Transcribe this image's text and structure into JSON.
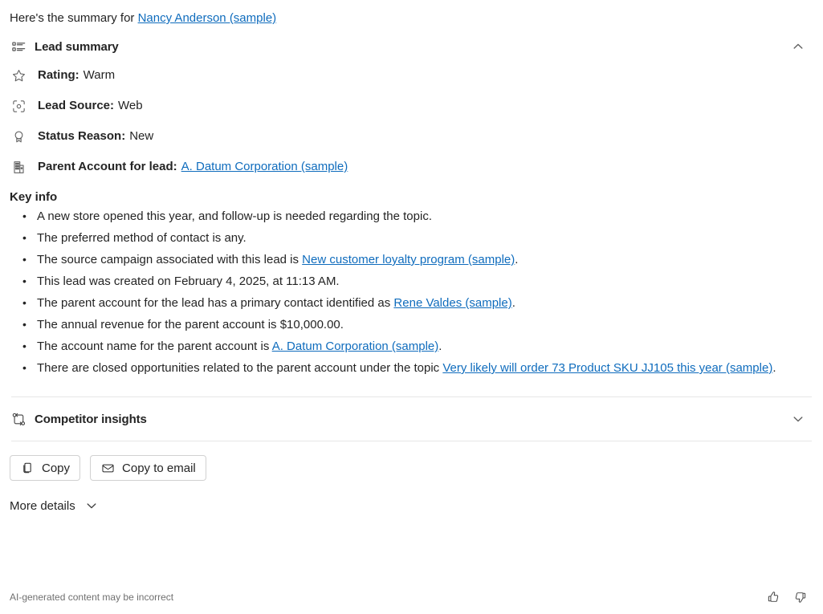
{
  "intro": {
    "prefix": "Here's the summary for ",
    "link": "Nancy Anderson (sample)"
  },
  "lead_summary": {
    "icon": "bulleted-list-icon",
    "title": "Lead summary",
    "collapse_icon": "chevron-up-icon",
    "attributes": [
      {
        "icon": "star-icon",
        "label": "Rating:",
        "value": "Warm"
      },
      {
        "icon": "target-icon",
        "label": "Lead Source:",
        "value": "Web"
      },
      {
        "icon": "ribbon-icon",
        "label": "Status Reason:",
        "value": "New"
      },
      {
        "icon": "building-icon",
        "label": "Parent Account for lead:",
        "value": "A. Datum Corporation (sample)",
        "value_is_link": true
      }
    ],
    "key_info": {
      "title": "Key info",
      "items": [
        {
          "parts": [
            {
              "t": "A new store opened this year, and follow-up is needed regarding the topic."
            }
          ]
        },
        {
          "parts": [
            {
              "t": "The preferred method of contact is any."
            }
          ]
        },
        {
          "parts": [
            {
              "t": "The source campaign associated with this lead is "
            },
            {
              "t": "New customer loyalty program (sample)",
              "link": true
            },
            {
              "t": "."
            }
          ]
        },
        {
          "parts": [
            {
              "t": "This lead was created on February 4, 2025, at 11:13 AM."
            }
          ]
        },
        {
          "parts": [
            {
              "t": "The parent account for the lead has a primary contact identified as "
            },
            {
              "t": "Rene Valdes (sample)",
              "link": true
            },
            {
              "t": "."
            }
          ]
        },
        {
          "parts": [
            {
              "t": "The annual revenue for the parent account is $10,000.00."
            }
          ]
        },
        {
          "parts": [
            {
              "t": "The account name for the parent account is "
            },
            {
              "t": "A. Datum Corporation (sample)",
              "link": true
            },
            {
              "t": "."
            }
          ]
        },
        {
          "parts": [
            {
              "t": "There are closed opportunities related to the parent account under the topic "
            },
            {
              "t": "Very likely will order 73 Product SKU JJ105 this year (sample)",
              "link": true
            },
            {
              "t": "."
            }
          ]
        }
      ]
    }
  },
  "competitor_insights": {
    "icon": "branch-swap-icon",
    "title": "Competitor insights",
    "expand_icon": "chevron-down-icon"
  },
  "actions": {
    "copy": {
      "icon": "copy-icon",
      "label": "Copy"
    },
    "copy_to_email": {
      "icon": "mail-icon",
      "label": "Copy to email"
    }
  },
  "more_details": {
    "label": "More details",
    "icon": "chevron-down-icon"
  },
  "footer": {
    "note": "AI-generated content may be incorrect",
    "thumbs_up": "thumb-like-icon",
    "thumbs_down": "thumb-dislike-icon"
  },
  "colors": {
    "link": "#0f6cbd",
    "text": "#242424",
    "muted": "#707070",
    "divider": "#e6e6e6",
    "border": "#d1d1d1"
  }
}
